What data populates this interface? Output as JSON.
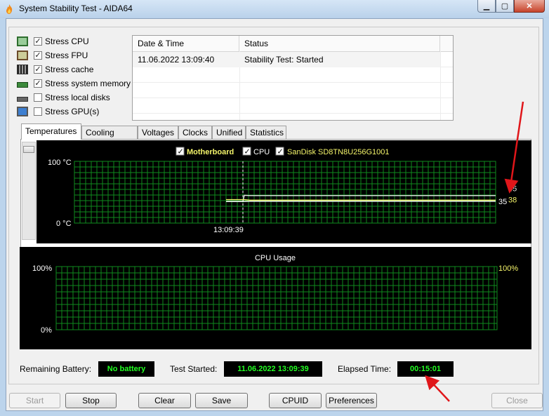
{
  "window": {
    "title": "System Stability Test - AIDA64"
  },
  "stress_options": [
    {
      "label": "Stress CPU",
      "checked": true,
      "icon": "cpu-chip-icon"
    },
    {
      "label": "Stress FPU",
      "checked": true,
      "icon": "fpu-chip-icon"
    },
    {
      "label": "Stress cache",
      "checked": true,
      "icon": "cache-chip-icon"
    },
    {
      "label": "Stress system memory",
      "checked": true,
      "icon": "memory-module-icon"
    },
    {
      "label": "Stress local disks",
      "checked": false,
      "icon": "hard-disk-icon"
    },
    {
      "label": "Stress GPU(s)",
      "checked": false,
      "icon": "monitor-icon"
    }
  ],
  "log": {
    "columns": [
      "Date & Time",
      "Status"
    ],
    "rows": [
      {
        "datetime": "11.06.2022 13:09:40",
        "status": "Stability Test: Started"
      }
    ]
  },
  "tabs": [
    "Temperatures",
    "Cooling Fans",
    "Voltages",
    "Clocks",
    "Unified",
    "Statistics"
  ],
  "active_tab": "Temperatures",
  "temperature_chart": {
    "legend": [
      {
        "label": "Motherboard",
        "checked": true,
        "color": "#f4f46a"
      },
      {
        "label": "CPU",
        "checked": true,
        "color": "#ffffff"
      },
      {
        "label": "SanDisk SD8TN8U256G1001",
        "checked": true,
        "color": "#f4f46a"
      }
    ],
    "y_max_label": "100 °C",
    "y_min_label": "0 °C",
    "y_range": [
      0,
      100
    ],
    "marker_time": "13:09:39",
    "series": [
      {
        "name": "CPU",
        "color": "#e6e6e6",
        "value": 45,
        "value_label": "45"
      },
      {
        "name": "Motherboard",
        "color": "#ffffff",
        "value": 35,
        "value_label": "35"
      },
      {
        "name": "SanDisk SD8TN8U256G1001",
        "color": "#f4f46a",
        "value": 38,
        "value_label": "38"
      }
    ]
  },
  "cpu_chart": {
    "title": "CPU Usage",
    "y_max_label": "100%",
    "y_min_label": "0%",
    "right_value_label": "100%",
    "y_range": [
      0,
      100
    ]
  },
  "status": {
    "battery_label": "Remaining Battery:",
    "battery_value": "No battery",
    "started_label": "Test Started:",
    "started_value": "11.06.2022 13:09:39",
    "elapsed_label": "Elapsed Time:",
    "elapsed_value": "00:15:01"
  },
  "buttons": {
    "start": "Start",
    "stop": "Stop",
    "clear": "Clear",
    "save": "Save",
    "cpuid": "CPUID",
    "preferences": "Preferences",
    "close": "Close"
  },
  "colors": {
    "grid": "#0f8a1e",
    "status_text": "#22ff22",
    "annotation_arrow": "#e0161a"
  }
}
